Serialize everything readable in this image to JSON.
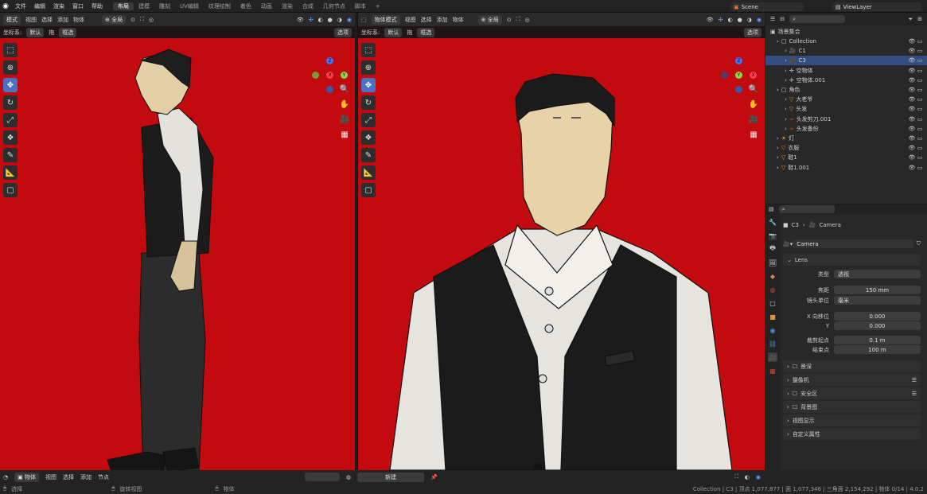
{
  "topbar": {
    "menus": [
      "文件",
      "编辑",
      "渲染",
      "窗口",
      "帮助"
    ],
    "workspaces": [
      "布局",
      "建模",
      "雕刻",
      "UV编辑",
      "纹理绘制",
      "着色",
      "动画",
      "渲染",
      "合成",
      "几何节点",
      "脚本"
    ],
    "active_workspace": "布局",
    "add_tab": "+",
    "scene": "Scene",
    "view_layer": "ViewLayer"
  },
  "viewport_left": {
    "mode": "模式",
    "menus": [
      "视图",
      "选择",
      "添加",
      "物体"
    ],
    "transform": "全局",
    "coord_label": "坐标系:",
    "coord_value": "默认",
    "drag_label": "拖",
    "drag_value": "框选",
    "options": "选项"
  },
  "viewport_right": {
    "mode": "物体模式",
    "menus": [
      "视图",
      "选择",
      "添加",
      "物体"
    ],
    "transform": "全局",
    "coord_label": "坐标系:",
    "coord_value": "默认",
    "drag_label": "拖",
    "drag_value": "框选",
    "options": "选项"
  },
  "outliner": {
    "root": "场景集合",
    "items": [
      {
        "name": "Collection",
        "indent": 1,
        "type": "collection",
        "selected": false
      },
      {
        "name": "C1",
        "indent": 2,
        "type": "camera",
        "selected": false
      },
      {
        "name": "C3",
        "indent": 2,
        "type": "camera",
        "selected": true
      },
      {
        "name": "空物体",
        "indent": 2,
        "type": "empty",
        "selected": false
      },
      {
        "name": "空物体.001",
        "indent": 2,
        "type": "empty",
        "selected": false
      },
      {
        "name": "角色",
        "indent": 1,
        "type": "collection",
        "selected": false
      },
      {
        "name": "大老爷",
        "indent": 2,
        "type": "mesh",
        "selected": false
      },
      {
        "name": "头发",
        "indent": 2,
        "type": "mesh",
        "selected": false
      },
      {
        "name": "头发剪刀.001",
        "indent": 2,
        "type": "curve",
        "selected": false
      },
      {
        "name": "头发备份",
        "indent": 2,
        "type": "curve",
        "selected": false
      },
      {
        "name": "灯",
        "indent": 1,
        "type": "light",
        "selected": false
      },
      {
        "name": "衣服",
        "indent": 1,
        "type": "mesh",
        "selected": false
      },
      {
        "name": "鞋1",
        "indent": 1,
        "type": "mesh",
        "selected": false
      },
      {
        "name": "鞋1.001",
        "indent": 1,
        "type": "mesh",
        "selected": false
      }
    ]
  },
  "properties": {
    "breadcrumb_object": "C3",
    "breadcrumb_data": "Camera",
    "datablock": "Camera",
    "lens_panel": "Lens",
    "type_label": "类型",
    "type_value": "透视",
    "focal_label": "焦距",
    "focal_value": "150 mm",
    "unit_label": "镜头单位",
    "unit_value": "毫米",
    "shiftx_label": "X 向移位",
    "shiftx_value": "0.000",
    "shifty_label": "Y",
    "shifty_value": "0.000",
    "clip_start_label": "裁剪起点",
    "clip_start_value": "0.1 m",
    "clip_end_label": "结束点",
    "clip_end_value": "100 m",
    "panels": [
      "景深",
      "摄像机",
      "安全区",
      "背景图",
      "视图显示",
      "自定义属性"
    ]
  },
  "bottom": {
    "mode": "物体",
    "menus": [
      "视图",
      "选择",
      "添加",
      "节点"
    ],
    "new_button": "新建",
    "status_left": "选择",
    "status_mid": "旋转视图",
    "status_right": "物体",
    "stats": "Collection | C3 | 顶点 1,077,877 | 面 1,077,346 | 三角面 2,154,292 | 物体 0/14 | 4.0.2"
  },
  "colors": {
    "viewport_bg": "#c20a0f",
    "accent": "#4a72c2",
    "selected_row": "#334d80"
  }
}
